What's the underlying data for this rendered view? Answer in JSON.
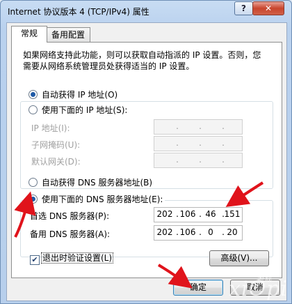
{
  "window": {
    "title": "Internet 协议版本 4 (TCP/IPv4) 属性",
    "help_label": "?",
    "close_label": "✕"
  },
  "tabs": [
    {
      "label": "常规"
    },
    {
      "label": "备用配置"
    }
  ],
  "description": "如果网络支持此功能，则可以获取自动指派的 IP 设置。否则，您需要从网络系统管理员处获得适当的 IP 设置。",
  "ip_section": {
    "auto_label": "自动获得 IP 地址(O)",
    "manual_label": "使用下面的 IP 地址(S):",
    "fields": [
      {
        "label": "IP 地址(I):",
        "octets": [
          "",
          "",
          "",
          ""
        ]
      },
      {
        "label": "子网掩码(U):",
        "octets": [
          "",
          "",
          "",
          ""
        ]
      },
      {
        "label": "默认网关(D):",
        "octets": [
          "",
          "",
          "",
          ""
        ]
      }
    ]
  },
  "dns_section": {
    "auto_label": "自动获得 DNS 服务器地址(B)",
    "manual_label": "使用下面的 DNS 服务器地址(E):",
    "selected": "manual",
    "fields": [
      {
        "label": "首选 DNS 服务器(P):",
        "octets": [
          "202",
          "106",
          "46",
          "151"
        ]
      },
      {
        "label": "备用 DNS 服务器(A):",
        "octets": [
          "202",
          "106",
          "0",
          "20"
        ]
      }
    ]
  },
  "validate_checkbox": {
    "label": "退出时验证设置(L)",
    "checked": true
  },
  "advanced_button": "高级(V)...",
  "ok_button": "确定",
  "cancel_button": "取消",
  "watermark": {
    "text": "xiOpi",
    "small": "游戏"
  },
  "colors": {
    "annotation_arrow": "#e0131b",
    "radio_dot": "#1f5aa6"
  }
}
